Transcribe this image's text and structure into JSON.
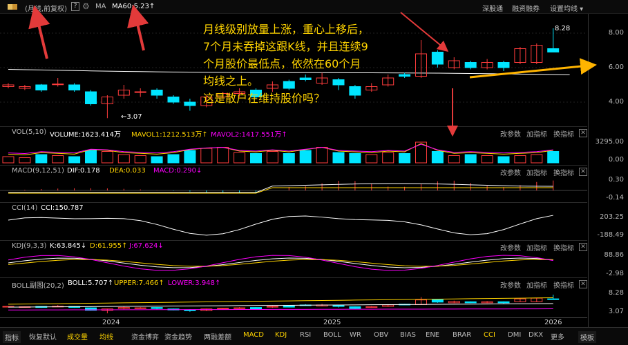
{
  "toolbar": {
    "mode": "(月线,前复权)",
    "help": "?",
    "ma_label": "MA",
    "ma60": "MA60:5.23",
    "arrow": "↑",
    "links": [
      "深股通",
      "融资融券",
      "设置均线"
    ]
  },
  "main": {
    "max_label": "8.28",
    "min_label": "3.07",
    "yticks": [
      "8.00",
      "6.00",
      "4.00"
    ]
  },
  "annotation": [
    "月线级别放量上涨，重心上移后，",
    "7个月未吞掉这跟K线，并且连续9",
    "个月股价最低点，依然在60个月",
    "均线之上。",
    "这是散户在维持股价吗？"
  ],
  "vol": {
    "name": "VOL(5,10)",
    "v": "VOLUME:1623.414万",
    "ma1": "MAVOL1:1212.513万",
    "ma2": "MAVOL2:1417.551万",
    "yticks": [
      "3295.00",
      "0.00"
    ]
  },
  "macd": {
    "name": "MACD(9,12,51)",
    "dif": "DIF:0.178",
    "dea": "DEA:0.033",
    "macd": "MACD:0.290",
    "yticks": [
      "0.30",
      "-0.14"
    ]
  },
  "cci": {
    "name": "CCI(14)",
    "v": "CCI:150.787",
    "yticks": [
      "203.25",
      "-188.49"
    ]
  },
  "kdj": {
    "name": "KDJ(9,3,3)",
    "k": "K:63.845",
    "d": "D:61.955",
    "j": "J:67.624",
    "yticks": [
      "88.86",
      "-2.98"
    ]
  },
  "boll": {
    "name": "BOLL副图(20,2)",
    "b": "BOLL:5.707",
    "u": "UPPER:7.466",
    "l": "LOWER:3.948",
    "yticks": [
      "8.28",
      "3.07"
    ]
  },
  "pane_buttons": [
    "改参数",
    "加指标",
    "换指标"
  ],
  "xaxis": [
    "2024",
    "2025",
    "2026"
  ],
  "bottom_tabs": [
    "指标",
    "恢复默认",
    "成交量",
    "均线",
    "资金博弈",
    "资金趋势",
    "两融差额",
    "MACD",
    "KDJ",
    "RSI",
    "BOLL",
    "WR",
    "OBV",
    "BIAS",
    "ENE",
    "BRAR",
    "CCI",
    "DMI",
    "DKX",
    "更多",
    "模板"
  ],
  "colors": {
    "up": "#ff3c3c",
    "down": "#00e5ff",
    "yellow": "#ffd400",
    "magenta": "#ff00ff",
    "white": "#ffffff",
    "red_arrow": "#e33a3a",
    "orange": "#ffb400"
  }
}
